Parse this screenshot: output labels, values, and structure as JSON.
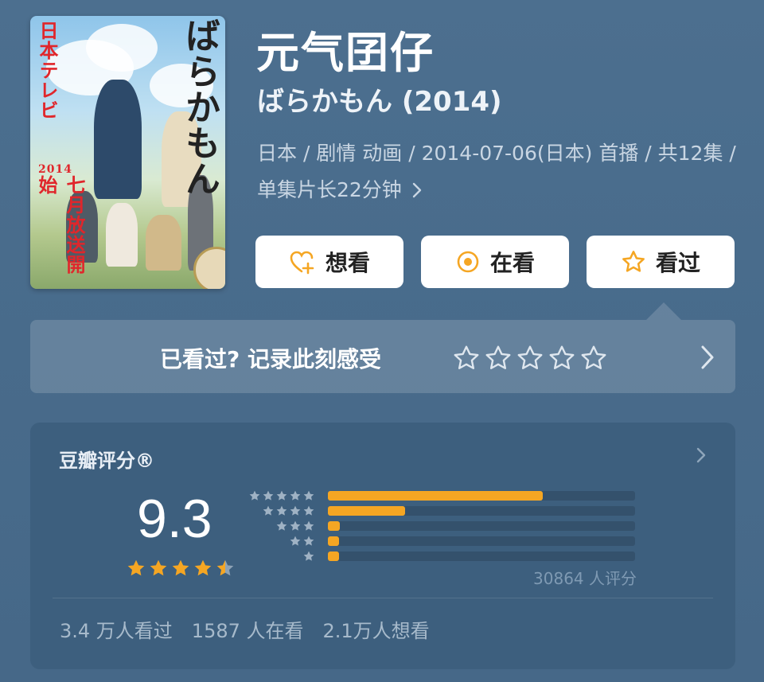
{
  "movie": {
    "title": "元气囝仔",
    "original_title": "ばらかもん (2014)",
    "meta_line": "日本 / 剧情 动画 / 2014-07-06(日本) 首播 / 共12集 / 单集片长22分钟",
    "poster": {
      "text_left": "日本テレビ",
      "text_year": "2014",
      "text_broadcast": "七月放送開始",
      "text_title": "ばらかもん"
    }
  },
  "actions": {
    "want": "想看",
    "watching": "在看",
    "watched": "看过"
  },
  "rate_prompt": {
    "label": "已看过? 记录此刻感受"
  },
  "rating": {
    "header": "豆瓣评分®",
    "score": "9.3",
    "stars_value": 4.5,
    "distribution": [
      {
        "stars": 5,
        "fraction": 0.7
      },
      {
        "stars": 4,
        "fraction": 0.25
      },
      {
        "stars": 3,
        "fraction": 0.04
      },
      {
        "stars": 2,
        "fraction": 0.03
      },
      {
        "stars": 1,
        "fraction": 0.03
      }
    ],
    "count_text": "30864 人评分",
    "stats": [
      "3.4 万人看过",
      "1587 人在看",
      "2.1万人想看"
    ]
  },
  "colors": {
    "accent": "#f5a623",
    "background": "#4a6d8c"
  }
}
